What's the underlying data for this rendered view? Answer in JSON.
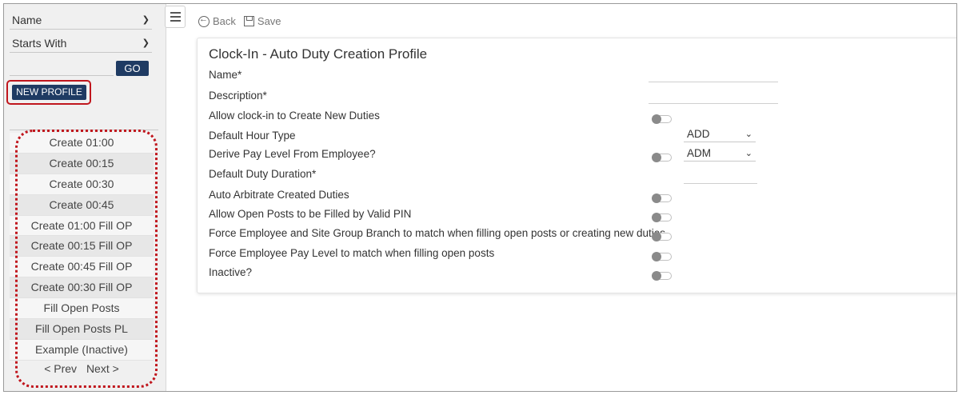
{
  "sidebar": {
    "filter_field": "Name",
    "filter_operator": "Starts With",
    "go_label": "GO",
    "new_profile_label": "NEW PROFILE",
    "items": [
      {
        "label": "Create 01:00"
      },
      {
        "label": "Create 00:15"
      },
      {
        "label": "Create 00:30"
      },
      {
        "label": "Create 00:45"
      },
      {
        "label": "Create 01:00 Fill OP"
      },
      {
        "label": "Create 00:15 Fill OP"
      },
      {
        "label": "Create 00:45 Fill OP"
      },
      {
        "label": "Create 00:30 Fill OP"
      },
      {
        "label": "Fill Open Posts"
      },
      {
        "label": "Fill Open Posts PL"
      },
      {
        "label": "Example (Inactive)"
      }
    ],
    "prev_label": "< Prev",
    "next_label": "Next >"
  },
  "toolbar": {
    "back_label": "Back",
    "save_label": "Save"
  },
  "form": {
    "title": "Clock-In - Auto Duty Creation Profile",
    "name_label": "Name*",
    "description_label": "Description*",
    "allow_clockin_label": "Allow clock-in to Create New Duties",
    "default_hour_type_label": "Default Hour Type",
    "default_hour_type_value": "ADD",
    "derive_pay_level_label": "Derive Pay Level From Employee?",
    "pay_level_value": "ADM",
    "default_duty_duration_label": "Default Duty Duration*",
    "auto_arbitrate_label": "Auto Arbitrate Created Duties",
    "allow_open_posts_label": "Allow Open Posts to be Filled by Valid PIN",
    "force_site_group_label": "Force Employee and Site Group Branch to match when filling open posts or creating new duties",
    "force_pay_level_label": "Force Employee Pay Level to match when filling open posts",
    "inactive_label": "Inactive?"
  },
  "icons": {
    "chevron": "chevron-down-icon",
    "menu": "hamburger-icon",
    "back": "back-arrow-icon",
    "save": "save-icon"
  },
  "colors": {
    "primary_button": "#1f3b63",
    "highlight_outline": "#c0161d",
    "toggle_off_knob": "#8a8a8a"
  }
}
